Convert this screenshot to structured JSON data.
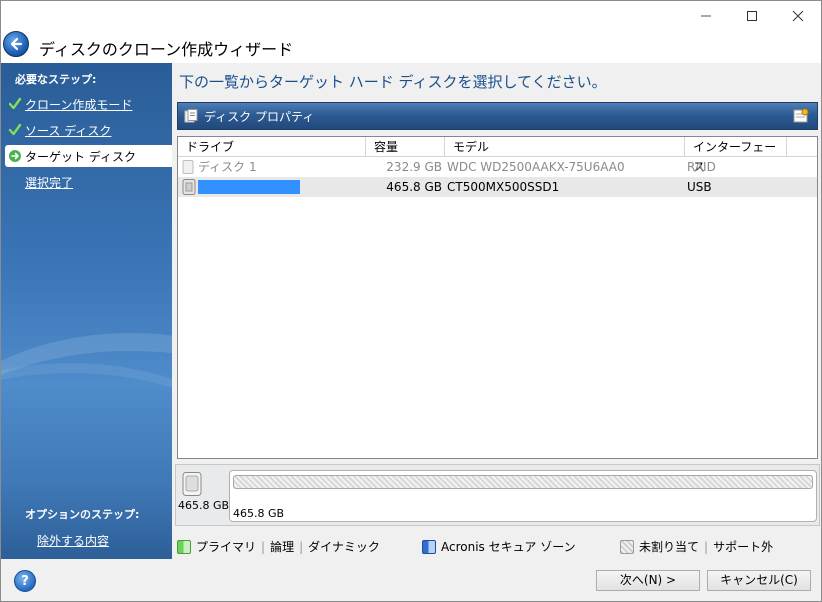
{
  "window": {
    "title": "ディスクのクローン作成ウィザード"
  },
  "sidebar": {
    "required_heading": "必要なステップ:",
    "items": [
      {
        "label": "クローン作成モード",
        "state": "done"
      },
      {
        "label": "ソース ディスク",
        "state": "done"
      },
      {
        "label": "ターゲット ディスク",
        "state": "active"
      },
      {
        "label": "選択完了",
        "state": "pending"
      }
    ],
    "optional_heading": "オプションのステップ:",
    "optional_items": [
      {
        "label": "除外する内容"
      }
    ]
  },
  "main": {
    "heading": "下の一覧からターゲット ハード ディスクを選択してください。",
    "toolbar": {
      "label": "ディスク プロパティ"
    },
    "table": {
      "columns": [
        "ドライブ",
        "容量",
        "モデル",
        "インターフェース"
      ],
      "rows": [
        {
          "drive": "ディスク 1",
          "capacity": "232.9 GB",
          "model": "WDC WD2500AAKX-75U6AA0",
          "interface": "RAID",
          "disabled": true,
          "selected": false
        },
        {
          "drive": "",
          "capacity": "465.8 GB",
          "model": "CT500MX500SSD1",
          "interface": "USB",
          "disabled": false,
          "selected": true
        }
      ]
    },
    "disk_map": {
      "disk_size": "465.8 GB",
      "partition_size": "465.8 GB"
    },
    "legend": {
      "primary": "プライマリ",
      "logical": "論理",
      "dynamic": "ダイナミック",
      "acronis_zone": "Acronis セキュア ゾーン",
      "unallocated": "未割り当て",
      "unsupported": "サポート外"
    }
  },
  "buttons": {
    "next": "次へ(N) >",
    "cancel": "キャンセル(C)"
  },
  "colors": {
    "accent": "#3390ff",
    "heading": "#1a4f8c",
    "sidebar": "#3a75b6"
  }
}
